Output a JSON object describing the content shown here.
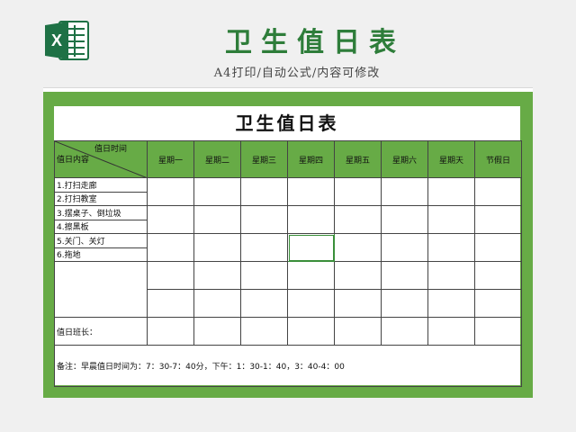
{
  "header": {
    "title": "卫生值日表",
    "subtitle": "A4打印/自动公式/内容可修改",
    "logo_icon": "excel-icon",
    "accent": "#2e7d3a"
  },
  "sheet": {
    "background": "#67ab46",
    "doc_title": "卫生值日表",
    "diag_top": "值日时间",
    "diag_bottom": "值日内容",
    "days": [
      "星期一",
      "星期二",
      "星期三",
      "星期四",
      "星期五",
      "星期六",
      "星期天",
      "节假日"
    ],
    "tasks": [
      "1.打扫走廊",
      "2.打扫教室",
      "3.摆桌子、倒垃圾",
      "4.擦黑板",
      "5.关门、关灯",
      "6.拖地"
    ],
    "monitor_label": "值日班长：",
    "note": "备注：早晨值日时间为：7：30-7：40分，下午：1：30-1：40，3：40-4：00"
  }
}
